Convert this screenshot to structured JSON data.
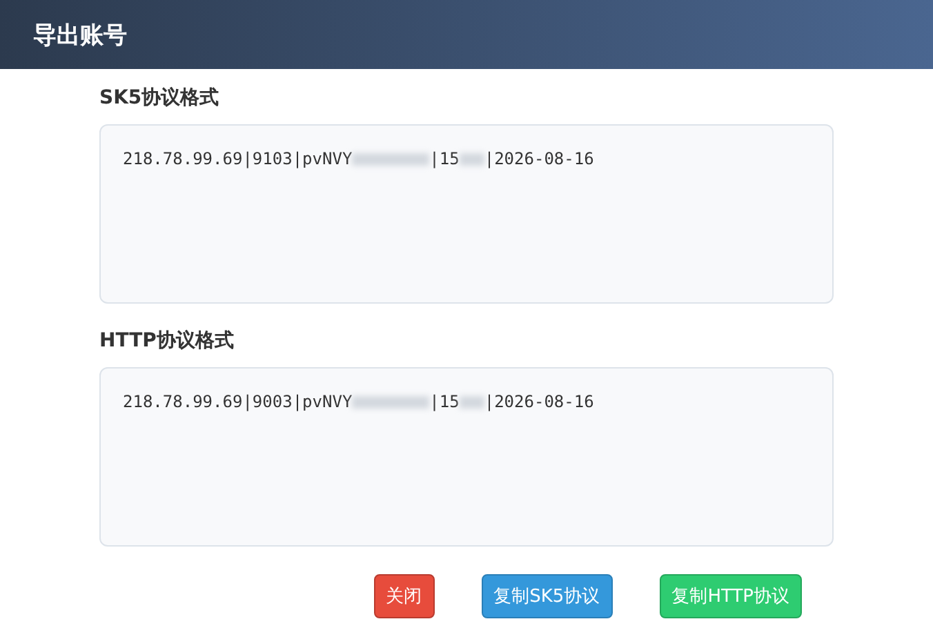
{
  "dialog": {
    "title": "导出账号"
  },
  "sections": [
    {
      "label": "SK5协议格式",
      "value": [
        {
          "kind": "text",
          "text": "218.78.99.69|9103|pvNVY"
        },
        {
          "kind": "longblur"
        },
        {
          "kind": "text",
          "text": "|15"
        },
        {
          "kind": "shortblur"
        },
        {
          "kind": "text",
          "text": "|2026-08-16"
        }
      ]
    },
    {
      "label": "HTTP协议格式",
      "value": [
        {
          "kind": "text",
          "text": "218.78.99.69|9003|pvNVY"
        },
        {
          "kind": "longblur"
        },
        {
          "kind": "text",
          "text": "|15"
        },
        {
          "kind": "shortblur"
        },
        {
          "kind": "text",
          "text": "|2026-08-16"
        }
      ]
    }
  ],
  "buttons": [
    {
      "label": "关闭",
      "kind": "danger"
    },
    {
      "label": "复制SK5协议",
      "kind": "info"
    },
    {
      "label": "复制HTTP协议",
      "kind": "success"
    }
  ]
}
